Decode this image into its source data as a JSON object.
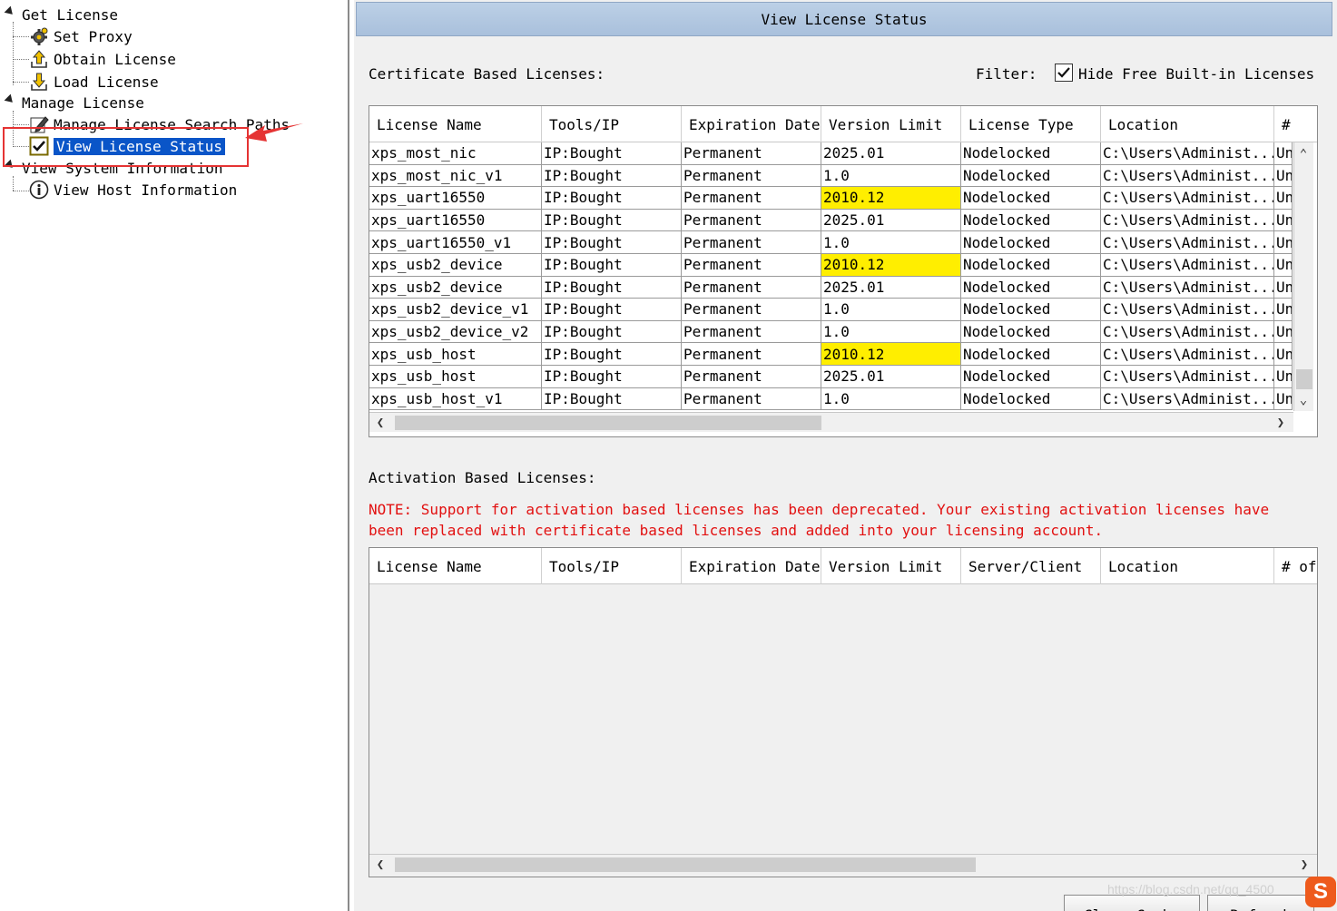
{
  "tree": {
    "get_license": "Get License",
    "set_proxy": "Set Proxy",
    "obtain_license": "Obtain License",
    "load_license": "Load License",
    "manage_license": "Manage License",
    "manage_paths": "Manage License Search Paths",
    "view_status": "View License Status",
    "view_system_info": "View System Information",
    "view_host_info": "View Host Information"
  },
  "panel": {
    "title": "View License Status",
    "cert_label": "Certificate Based Licenses:",
    "filter_label": "Filter:",
    "filter_option": "Hide Free Built-in Licenses",
    "filter_checked": true,
    "activation_label": "Activation Based Licenses:",
    "note": "NOTE: Support for activation based licenses has been deprecated. Your existing activation licenses have been replaced with certificate based licenses and added into your licensing account.",
    "clear_cache": "Clear Cache",
    "refresh": "Refresh"
  },
  "cert_table": {
    "columns": [
      "License Name",
      "Tools/IP",
      "Expiration Date",
      "Version Limit",
      "License Type",
      "Location",
      "#"
    ],
    "highlight_color": "#ffee00",
    "rows": [
      {
        "name": "xps_most_nic",
        "tools": "IP:Bought",
        "expiration": "Permanent",
        "version": "2025.01",
        "type": "Nodelocked",
        "location": "C:\\Users\\Administ...",
        "count": "Un",
        "highlight": false
      },
      {
        "name": "xps_most_nic_v1",
        "tools": "IP:Bought",
        "expiration": "Permanent",
        "version": "1.0",
        "type": "Nodelocked",
        "location": "C:\\Users\\Administ...",
        "count": "Un",
        "highlight": false
      },
      {
        "name": "xps_uart16550",
        "tools": "IP:Bought",
        "expiration": "Permanent",
        "version": "2010.12",
        "type": "Nodelocked",
        "location": "C:\\Users\\Administ...",
        "count": "Un",
        "highlight": true
      },
      {
        "name": "xps_uart16550",
        "tools": "IP:Bought",
        "expiration": "Permanent",
        "version": "2025.01",
        "type": "Nodelocked",
        "location": "C:\\Users\\Administ...",
        "count": "Un",
        "highlight": false
      },
      {
        "name": "xps_uart16550_v1",
        "tools": "IP:Bought",
        "expiration": "Permanent",
        "version": "1.0",
        "type": "Nodelocked",
        "location": "C:\\Users\\Administ...",
        "count": "Un",
        "highlight": false
      },
      {
        "name": "xps_usb2_device",
        "tools": "IP:Bought",
        "expiration": "Permanent",
        "version": "2010.12",
        "type": "Nodelocked",
        "location": "C:\\Users\\Administ...",
        "count": "Un",
        "highlight": true
      },
      {
        "name": "xps_usb2_device",
        "tools": "IP:Bought",
        "expiration": "Permanent",
        "version": "2025.01",
        "type": "Nodelocked",
        "location": "C:\\Users\\Administ...",
        "count": "Un",
        "highlight": false
      },
      {
        "name": "xps_usb2_device_v1",
        "tools": "IP:Bought",
        "expiration": "Permanent",
        "version": "1.0",
        "type": "Nodelocked",
        "location": "C:\\Users\\Administ...",
        "count": "Un",
        "highlight": false
      },
      {
        "name": "xps_usb2_device_v2",
        "tools": "IP:Bought",
        "expiration": "Permanent",
        "version": "1.0",
        "type": "Nodelocked",
        "location": "C:\\Users\\Administ...",
        "count": "Un",
        "highlight": false
      },
      {
        "name": "xps_usb_host",
        "tools": "IP:Bought",
        "expiration": "Permanent",
        "version": "2010.12",
        "type": "Nodelocked",
        "location": "C:\\Users\\Administ...",
        "count": "Un",
        "highlight": true
      },
      {
        "name": "xps_usb_host",
        "tools": "IP:Bought",
        "expiration": "Permanent",
        "version": "2025.01",
        "type": "Nodelocked",
        "location": "C:\\Users\\Administ...",
        "count": "Un",
        "highlight": false
      },
      {
        "name": "xps_usb_host_v1",
        "tools": "IP:Bought",
        "expiration": "Permanent",
        "version": "1.0",
        "type": "Nodelocked",
        "location": "C:\\Users\\Administ...",
        "count": "Un",
        "highlight": false
      }
    ]
  },
  "act_table": {
    "columns": [
      "License Name",
      "Tools/IP",
      "Expiration Date",
      "Version Limit",
      "Server/Client",
      "Location",
      "# of"
    ]
  },
  "watermark": "https://blog.csdn.net/qq_4500"
}
